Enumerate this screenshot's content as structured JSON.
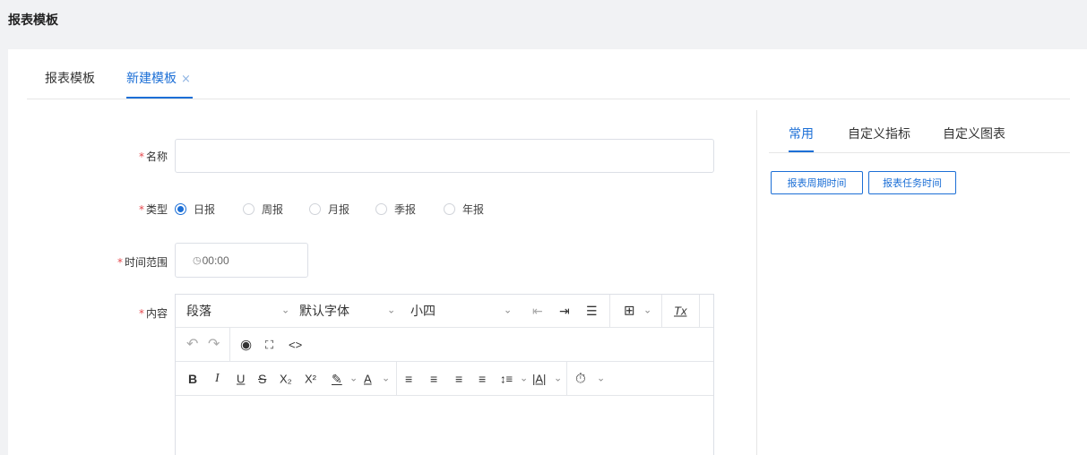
{
  "header": {
    "title": "报表模板"
  },
  "tabs": [
    {
      "label": "报表模板",
      "active": false
    },
    {
      "label": "新建模板",
      "active": true,
      "close": "×"
    }
  ],
  "form": {
    "name": {
      "required_mark": "*",
      "label": "名称",
      "value": ""
    },
    "type": {
      "required_mark": "*",
      "label": "类型",
      "options": [
        "日报",
        "周报",
        "月报",
        "季报",
        "年报"
      ],
      "selected": "日报"
    },
    "time_range": {
      "required_mark": "*",
      "label": "时间范围",
      "value": "00:00",
      "icon": "clock-icon"
    },
    "content": {
      "required_mark": "*",
      "label": "内容"
    }
  },
  "editor": {
    "paragraph_select": "段落",
    "font_select": "默认字体",
    "size_select": "小四",
    "chevron": "⌄",
    "icons": {
      "outdent": "⇤",
      "indent": "⇥",
      "line_height_list": "☰",
      "table": "⊞",
      "clear_format": "Tx",
      "undo": "↶",
      "redo": "↷",
      "preview": "◉",
      "fullscreen": "⛶",
      "code": "<>",
      "bold": "B",
      "italic": "I",
      "underline": "U",
      "strike": "S",
      "subscript": "X₂",
      "superscript": "X²",
      "highlight": "✎",
      "font_color": "A",
      "align_left": "≡",
      "align_center": "≡",
      "align_right": "≡",
      "justify": "≡",
      "line_height": "↕≡",
      "letter_spacing": "|A|",
      "insert_time": "⏱"
    }
  },
  "right_panel": {
    "tabs": [
      "常用",
      "自定义指标",
      "自定义图表"
    ],
    "active_tab": "常用",
    "buttons": [
      "报表周期时间",
      "报表任务时间"
    ]
  },
  "colors": {
    "accent": "#1c6fd6",
    "required": "#e5484d",
    "header_bg": "#f1f2f4"
  }
}
